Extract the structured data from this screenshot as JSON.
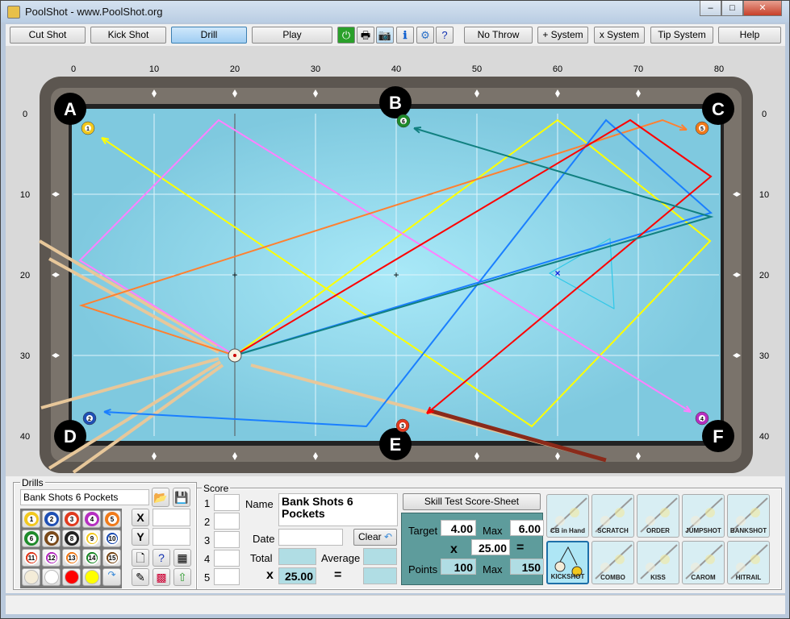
{
  "window": {
    "title": "PoolShot - www.PoolShot.org",
    "controls": [
      "–",
      "□",
      "✕"
    ]
  },
  "toolbar": {
    "buttons": [
      "Cut Shot",
      "Kick Shot",
      "Drill",
      "Play"
    ],
    "active": "Drill",
    "icons": [
      "power-icon",
      "printer-icon",
      "camera-icon",
      "info-icon",
      "gear-icon",
      "help-document-icon"
    ],
    "right_buttons": [
      "No Throw Lines",
      "+ System",
      "x System",
      "Tip System",
      "Help"
    ]
  },
  "table": {
    "x_ticks": [
      "0",
      "10",
      "20",
      "30",
      "40",
      "50",
      "60",
      "70",
      "80"
    ],
    "y_ticks": [
      "0",
      "10",
      "20",
      "30",
      "40"
    ],
    "pockets": [
      "A",
      "B",
      "C",
      "D",
      "E",
      "F"
    ],
    "cue_ball": [
      20,
      30
    ],
    "balls": [
      {
        "n": "1",
        "x": 1.8,
        "y": 1.8,
        "color": "#f2c81e"
      },
      {
        "n": "2",
        "x": 2,
        "y": 37.8,
        "color": "#1e4fb4"
      },
      {
        "n": "3",
        "x": 40.8,
        "y": 38.7,
        "color": "#e03a1e"
      },
      {
        "n": "4",
        "x": 77.9,
        "y": 37.8,
        "color": "#b52ec0"
      },
      {
        "n": "5",
        "x": 77.9,
        "y": 1.8,
        "color": "#f07a1a"
      },
      {
        "n": "6",
        "x": 40.9,
        "y": 0.9,
        "color": "#1e8a2a"
      }
    ],
    "paths": [
      {
        "color": "#ffff00",
        "points": [
          [
            20,
            30
          ],
          [
            60,
            0.8
          ],
          [
            78.9,
            15.8
          ],
          [
            56.8,
            38.8
          ],
          [
            3.5,
            3
          ]
        ]
      },
      {
        "color": "#ff80ff",
        "points": [
          [
            20,
            30
          ],
          [
            0.8,
            18.2
          ],
          [
            18,
            0.8
          ],
          [
            76.5,
            37
          ]
        ]
      },
      {
        "color": "#ff8030",
        "points": [
          [
            20,
            30
          ],
          [
            1,
            23.8
          ],
          [
            73,
            0.8
          ],
          [
            76,
            2
          ]
        ]
      },
      {
        "color": "#1a7fff",
        "points": [
          [
            20,
            30
          ],
          [
            79,
            12.3
          ],
          [
            66,
            0.8
          ],
          [
            36.3,
            38.8
          ],
          [
            3.8,
            37
          ]
        ]
      },
      {
        "color": "#ff0000",
        "points": [
          [
            20,
            30
          ],
          [
            69,
            0.8
          ],
          [
            79,
            7.8
          ],
          [
            43.8,
            37.2
          ]
        ]
      },
      {
        "color": "#118080",
        "points": [
          [
            20,
            30
          ],
          [
            79,
            12.8
          ],
          [
            42.2,
            1.8
          ]
        ]
      }
    ],
    "target_marker": [
      60,
      19.8
    ],
    "markers": [
      [
        20,
        20
      ],
      [
        40,
        20
      ]
    ]
  },
  "drills": {
    "legend": "Drills",
    "name": "Bank Shots 6 Pockets",
    "balls": [
      {
        "n": "1",
        "c": "#f2c81e"
      },
      {
        "n": "2",
        "c": "#1e4fb4"
      },
      {
        "n": "3",
        "c": "#e03a1e"
      },
      {
        "n": "4",
        "c": "#b52ec0"
      },
      {
        "n": "5",
        "c": "#f07a1a"
      },
      {
        "n": "6",
        "c": "#1e8a2a"
      },
      {
        "n": "7",
        "c": "#7a4a1a"
      },
      {
        "n": "8",
        "c": "#222222"
      },
      {
        "n": "9",
        "c": "#f2c81e"
      },
      {
        "n": "10",
        "c": "#1e4fb4"
      },
      {
        "n": "11",
        "c": "#e03a1e"
      },
      {
        "n": "12",
        "c": "#b52ec0"
      },
      {
        "n": "13",
        "c": "#f07a1a"
      },
      {
        "n": "14",
        "c": "#1e8a2a"
      },
      {
        "n": "15",
        "c": "#7a4a1a"
      }
    ],
    "x_label": "X",
    "y_label": "Y",
    "x_value": "",
    "y_value": ""
  },
  "score": {
    "legend": "Score",
    "rows": [
      "1",
      "2",
      "3",
      "4",
      "5"
    ],
    "name_label": "Name",
    "name": "Bank Shots 6 Pockets",
    "date_label": "Date",
    "date": "",
    "clear": "Clear",
    "total_label": "Total",
    "total": "",
    "average_label": "Average",
    "average": "",
    "x": "x",
    "multiplier": "25.00",
    "eq": "=",
    "result": ""
  },
  "skill": {
    "button": "Skill Test Score-Sheet",
    "target_label": "Target",
    "target": "4.00",
    "max_label": "Max",
    "max": "6.00",
    "x": "x",
    "multiplier": "25.00",
    "eq": "=",
    "points_label": "Points",
    "points": "100",
    "points_max_label": "Max",
    "points_max": "150"
  },
  "shot_types": [
    {
      "label": "CB in Hand",
      "active": false
    },
    {
      "label": "SCRATCH",
      "active": false
    },
    {
      "label": "ORDER",
      "active": false
    },
    {
      "label": "JUMPSHOT",
      "active": false
    },
    {
      "label": "BANKSHOT",
      "active": false
    },
    {
      "label": "KICKSHOT",
      "active": true
    },
    {
      "label": "COMBO",
      "active": false
    },
    {
      "label": "KISS",
      "active": false
    },
    {
      "label": "CAROM",
      "active": false
    },
    {
      "label": "HITRAIL",
      "active": false
    }
  ]
}
